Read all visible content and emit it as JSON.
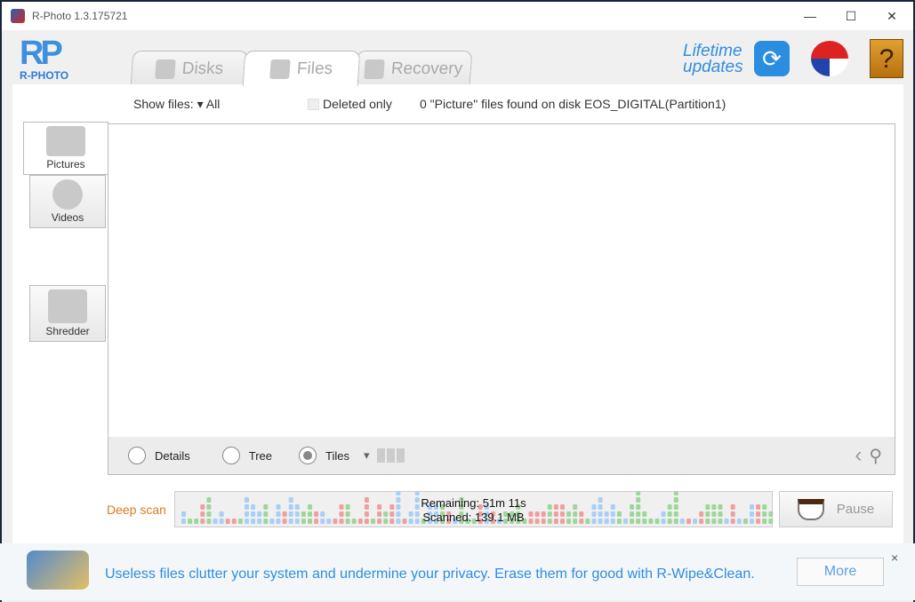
{
  "window": {
    "title": "R-Photo 1.3.175721",
    "controls": [
      "minimize",
      "maximize",
      "close"
    ]
  },
  "logo": {
    "mark": "RP",
    "name": "R-PHOTO"
  },
  "tabs": [
    {
      "label": "Disks",
      "icon": "disk-icon"
    },
    {
      "label": "Files",
      "icon": "files-icon",
      "active": true
    },
    {
      "label": "Recovery",
      "icon": "recovery-icon"
    }
  ],
  "header": {
    "lifetime_line1": "Lifetime",
    "lifetime_line2": "updates",
    "help": "?"
  },
  "filters": {
    "show_files_label": "Show files:",
    "show_files_value": "All",
    "deleted_only": "Deleted only",
    "deleted_only_checked": false,
    "status": "0 \"Picture\" files found on disk EOS_DIGITAL(Partition1)"
  },
  "sidebar": [
    {
      "label": "Pictures",
      "active": true
    },
    {
      "label": "Videos"
    },
    {
      "label": "Shredder"
    }
  ],
  "view": {
    "options": [
      "Details",
      "Tree",
      "Tiles"
    ],
    "selected": "Tiles"
  },
  "scan": {
    "label": "Deep scan",
    "remaining": "Remaining: 51m 11s",
    "scanned": "Scanned: 139.1 MB",
    "pause": "Pause",
    "colors": {
      "blue": "#a8cff5",
      "green": "#9ed69a",
      "red": "#eea0a0"
    }
  },
  "ad": {
    "text": "Useless files clutter your system and undermine your privacy. Erase them for good with R-Wipe&Clean.",
    "more": "More",
    "close": "×"
  },
  "colors": {
    "accent": "#2f8ce0",
    "scan_label": "#e07a20"
  }
}
